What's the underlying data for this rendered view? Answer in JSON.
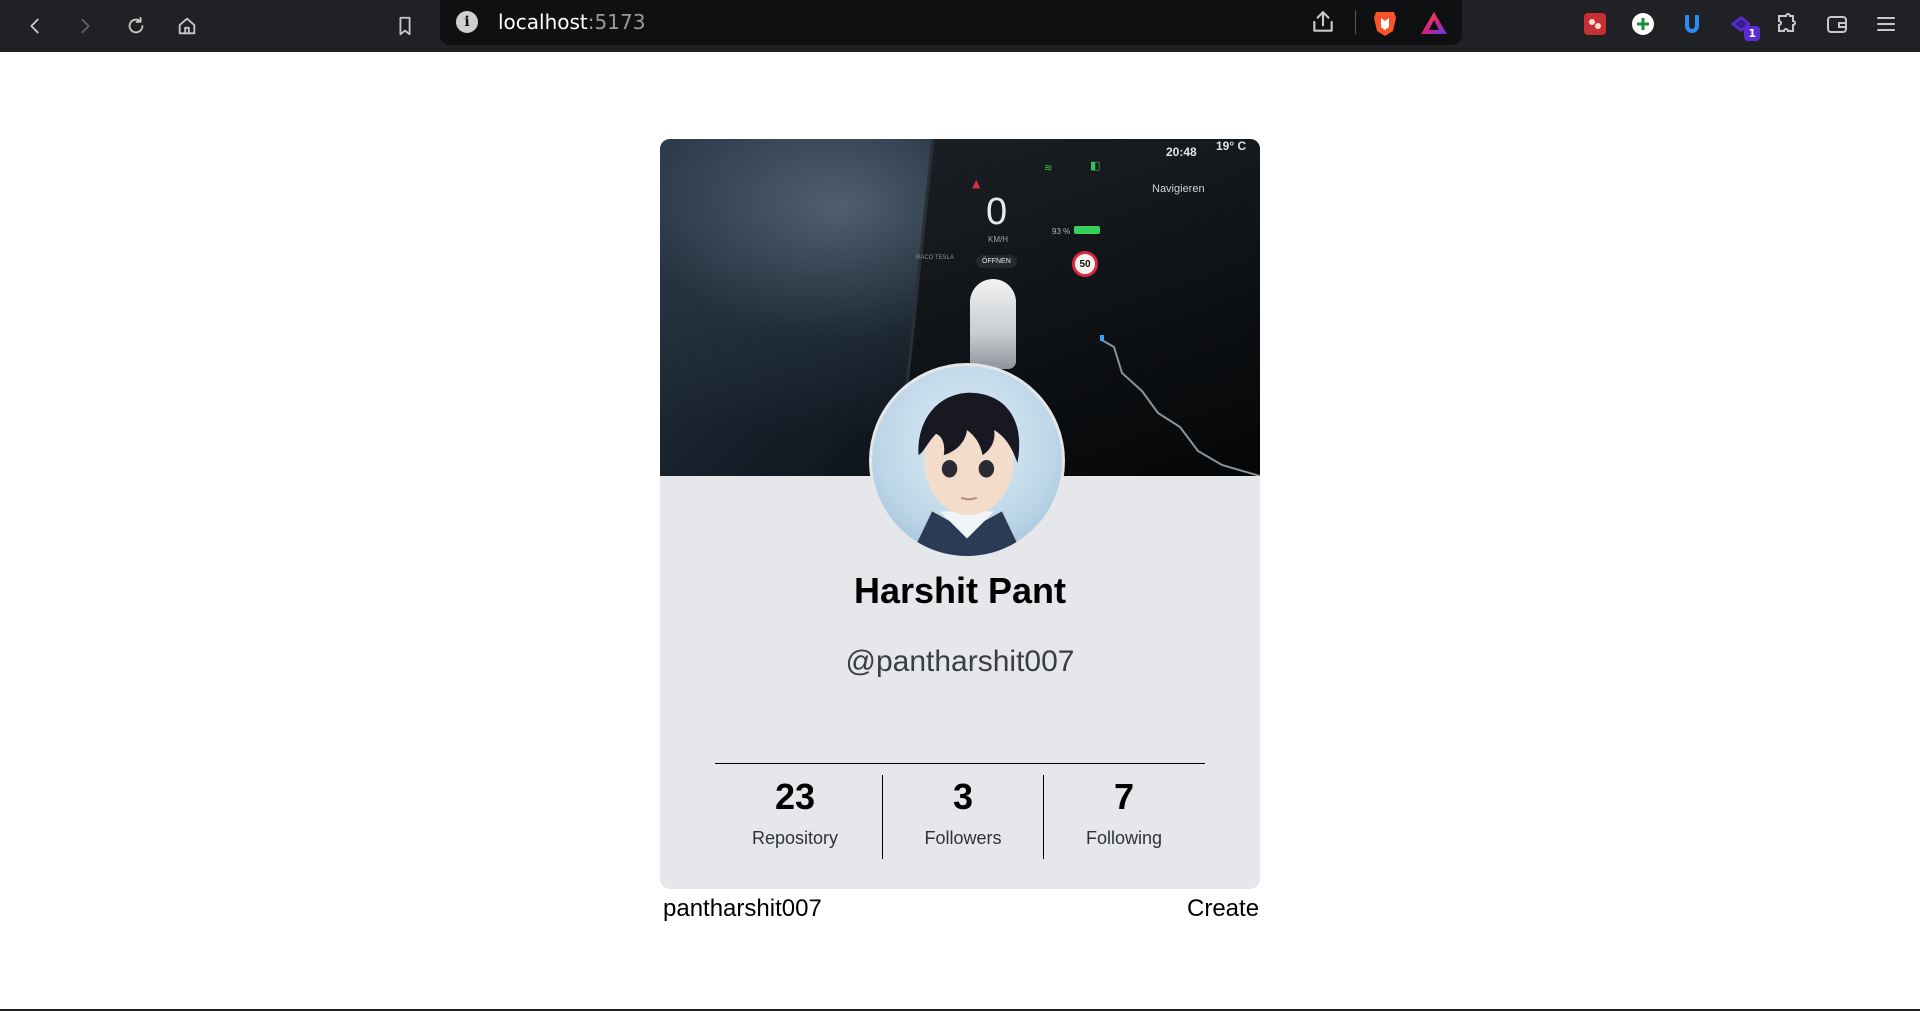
{
  "browser": {
    "url_host": "localhost",
    "url_port": ":5173",
    "info_glyph": "i",
    "extension_badge": "1",
    "colors": {
      "toolbar": "#202124",
      "urlbar": "#0f1011"
    },
    "icons": [
      "back-icon",
      "forward-icon",
      "reload-icon",
      "home-icon",
      "bookmark-icon",
      "site-info-icon",
      "share-icon",
      "brave-shields-icon",
      "brave-rewards-icon",
      "extension-red-icon",
      "extension-plus-icon",
      "extension-u-icon",
      "extension-purple-icon",
      "extensions-puzzle-icon",
      "wallet-icon",
      "menu-icon"
    ]
  },
  "banner": {
    "clock": "20:48",
    "temperature": "19° C",
    "speed": "0",
    "speed_unit": "KM/H",
    "battery": "93 %",
    "navigate": "Navigieren",
    "open_button": "ÖFFNEN",
    "vehicle_name": "RACO TESLA",
    "speed_limit": "50"
  },
  "profile": {
    "name": "Harshit Pant",
    "handle": "@pantharshit007",
    "stats": [
      {
        "value": "23",
        "label": "Repository"
      },
      {
        "value": "3",
        "label": "Followers"
      },
      {
        "value": "7",
        "label": "Following"
      }
    ]
  },
  "footer": {
    "left": "pantharshit007",
    "right": "Create"
  }
}
